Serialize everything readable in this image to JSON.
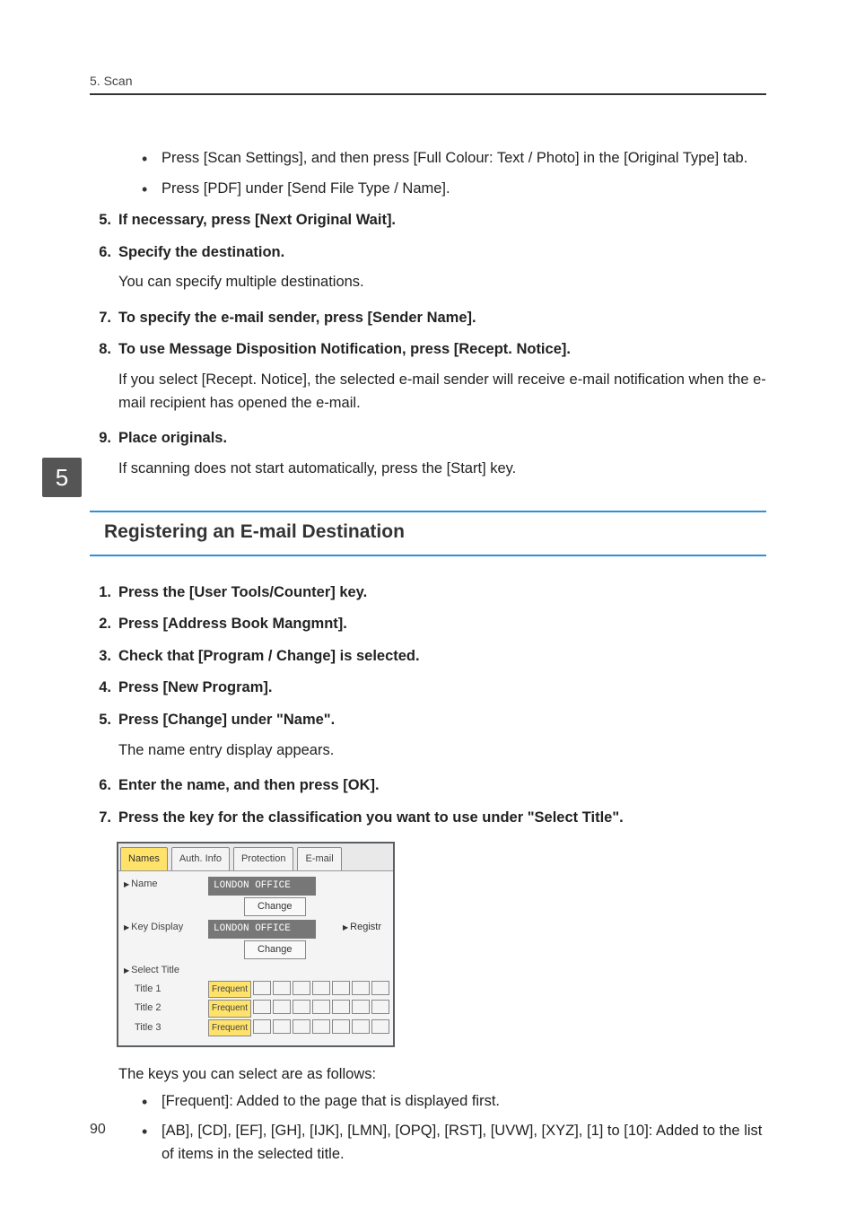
{
  "header": {
    "breadcrumb": "5. Scan"
  },
  "chapter_tab": "5",
  "page_number": "90",
  "upper_bullets": [
    "Press [Scan Settings], and then press [Full Colour: Text / Photo] in the [Original Type] tab.",
    "Press [PDF] under [Send File Type / Name]."
  ],
  "upper_list": [
    {
      "num": "5.",
      "head": "If necessary, press [Next Original Wait]."
    },
    {
      "num": "6.",
      "head": "Specify the destination.",
      "para": "You can specify multiple destinations."
    },
    {
      "num": "7.",
      "head": "To specify the e-mail sender, press [Sender Name]."
    },
    {
      "num": "8.",
      "head": "To use Message Disposition Notification, press [Recept. Notice].",
      "para": "If you select [Recept. Notice], the selected e-mail sender will receive e-mail notification when the e-mail recipient has opened the e-mail."
    },
    {
      "num": "9.",
      "head": "Place originals.",
      "para": "If scanning does not start automatically, press the [Start] key."
    }
  ],
  "section_heading": "Registering an E-mail Destination",
  "lower_list": [
    {
      "num": "1.",
      "head": "Press the [User Tools/Counter] key."
    },
    {
      "num": "2.",
      "head": "Press [Address Book Mangmnt]."
    },
    {
      "num": "3.",
      "head": "Check that [Program / Change] is selected."
    },
    {
      "num": "4.",
      "head": "Press [New Program]."
    },
    {
      "num": "5.",
      "head": "Press [Change] under \"Name\".",
      "para": "The name entry display appears."
    },
    {
      "num": "6.",
      "head": "Enter the name, and then press [OK]."
    },
    {
      "num": "7.",
      "head": "Press the key for the classification you want to use under \"Select Title\"."
    }
  ],
  "ui": {
    "tabs": [
      "Names",
      "Auth. Info",
      "Protection",
      "E-mail"
    ],
    "name_label": "Name",
    "name_value": "LONDON OFFICE",
    "change_label": "Change",
    "key_display_label": "Key Display",
    "key_display_value": "LONDON OFFICE",
    "registration_label": "Registr",
    "select_title_label": "Select Title",
    "title_rows": [
      {
        "label": "Title 1",
        "freq": "Frequent"
      },
      {
        "label": "Title 2",
        "freq": "Frequent"
      },
      {
        "label": "Title 3",
        "freq": "Frequent"
      }
    ]
  },
  "post_ui_para": "The keys you can select are as follows:",
  "post_ui_bullets": [
    "[Frequent]: Added to the page that is displayed first.",
    "[AB], [CD], [EF], [GH], [IJK], [LMN], [OPQ], [RST], [UVW], [XYZ], [1] to [10]: Added to the list of items in the selected title."
  ]
}
